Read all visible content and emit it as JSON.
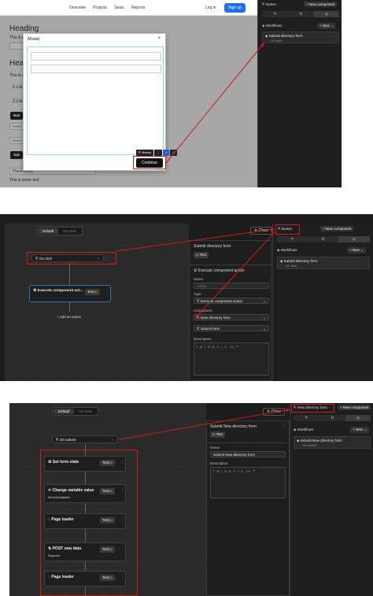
{
  "panel1": {
    "nav": {
      "links": [
        "Overview",
        "Projects",
        "Tasks",
        "Reports"
      ],
      "login": "Log in",
      "signup": "Sign up"
    },
    "background_page": {
      "heading1": "Heading",
      "text1": "This is so",
      "heading2": "Hea",
      "text2": "This is s",
      "list1": "1 Lis",
      "list2": "2 Lis",
      "btn1": "Butt",
      "field1": "Name",
      "field2": "Name",
      "btn2": "Sub",
      "field3": "Placeholder",
      "text_bottom": "This is some text"
    },
    "modal": {
      "title": "Modal",
      "close": "×",
      "toolbar_label": "Button",
      "continue": "Continue"
    },
    "right_panel": {
      "selected": "Button",
      "new_component": "New component",
      "workflows_label": "Workflows",
      "new_label": "New",
      "workflow": {
        "title": "Submit directory form",
        "trigger": "On click"
      }
    }
  },
  "panel2": {
    "segment": [
      "Default",
      "On error"
    ],
    "trigger": "On click",
    "action_node": {
      "title": "Execute component act...",
      "test": "Test"
    },
    "add_action": "Add an action",
    "close": "Close",
    "mid_panel": {
      "title": "Submit directory form",
      "test": "Test",
      "section": "Execute component action",
      "name_label": "Name",
      "name_placeholder": "Action",
      "type_label": "Type",
      "type_value": "Execute component action",
      "component_label": "Component",
      "component_value": "New directory form",
      "action_value": "Submit form",
      "description_label": "Description",
      "rte": [
        "T",
        "B",
        "I",
        "S",
        "A",
        "≡",
        "•",
        "1.",
        "</>",
        "❝"
      ]
    },
    "right_panel": {
      "selected": "Button",
      "new_component": "New component",
      "workflows_label": "Workflows",
      "new_label": "New",
      "workflow": {
        "title": "Submit directory form",
        "trigger": "On click"
      }
    }
  },
  "panel3": {
    "segment": [
      "Default",
      "On error"
    ],
    "trigger": "On submit",
    "nodes": [
      {
        "title": "Set form state",
        "sub": "",
        "test": "Test"
      },
      {
        "title": "Change variable value",
        "sub": "isFormDisabled",
        "test": "Test"
      },
      {
        "title": "Page loader",
        "sub": "",
        "test": "Test"
      },
      {
        "title": "POST new data",
        "sub": "Request",
        "test": "Test"
      },
      {
        "title": "Page loader",
        "sub": "",
        "test": "Test"
      }
    ],
    "close": "Close",
    "mid_panel": {
      "title": "Submit New directory form",
      "test": "Test",
      "name_label": "Name",
      "name_value": "Submit New directory form",
      "description_label": "Description",
      "rte": [
        "T",
        "B",
        "I",
        "S",
        "A",
        "≡",
        "•",
        "1.",
        "</>",
        "❝"
      ]
    },
    "right_panel": {
      "selected": "New directory form",
      "new_component": "New component",
      "workflows_label": "Workflows",
      "new_label": "New",
      "workflow": {
        "title": "Submit New directory form",
        "trigger": "On submit"
      }
    }
  },
  "colors": {
    "annotation_red": "#d01a1a",
    "signup_blue": "#1f6fe5",
    "dark_bg": "#1e1e1e"
  }
}
